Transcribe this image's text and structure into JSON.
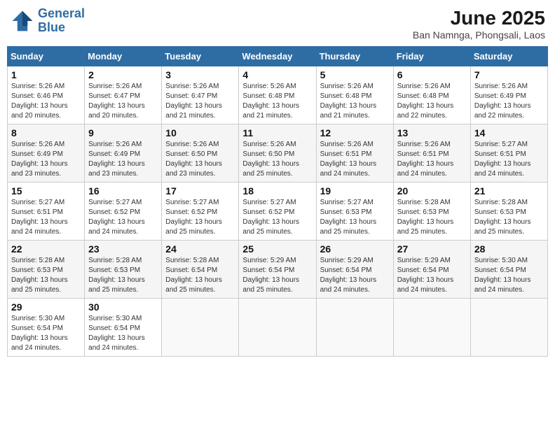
{
  "header": {
    "logo_line1": "General",
    "logo_line2": "Blue",
    "month_year": "June 2025",
    "location": "Ban Namnga, Phongsali, Laos"
  },
  "weekdays": [
    "Sunday",
    "Monday",
    "Tuesday",
    "Wednesday",
    "Thursday",
    "Friday",
    "Saturday"
  ],
  "weeks": [
    [
      {
        "day": "1",
        "sunrise": "5:26 AM",
        "sunset": "6:46 PM",
        "daylight": "13 hours and 20 minutes."
      },
      {
        "day": "2",
        "sunrise": "5:26 AM",
        "sunset": "6:47 PM",
        "daylight": "13 hours and 20 minutes."
      },
      {
        "day": "3",
        "sunrise": "5:26 AM",
        "sunset": "6:47 PM",
        "daylight": "13 hours and 21 minutes."
      },
      {
        "day": "4",
        "sunrise": "5:26 AM",
        "sunset": "6:48 PM",
        "daylight": "13 hours and 21 minutes."
      },
      {
        "day": "5",
        "sunrise": "5:26 AM",
        "sunset": "6:48 PM",
        "daylight": "13 hours and 21 minutes."
      },
      {
        "day": "6",
        "sunrise": "5:26 AM",
        "sunset": "6:48 PM",
        "daylight": "13 hours and 22 minutes."
      },
      {
        "day": "7",
        "sunrise": "5:26 AM",
        "sunset": "6:49 PM",
        "daylight": "13 hours and 22 minutes."
      }
    ],
    [
      {
        "day": "8",
        "sunrise": "5:26 AM",
        "sunset": "6:49 PM",
        "daylight": "13 hours and 23 minutes."
      },
      {
        "day": "9",
        "sunrise": "5:26 AM",
        "sunset": "6:49 PM",
        "daylight": "13 hours and 23 minutes."
      },
      {
        "day": "10",
        "sunrise": "5:26 AM",
        "sunset": "6:50 PM",
        "daylight": "13 hours and 23 minutes."
      },
      {
        "day": "11",
        "sunrise": "5:26 AM",
        "sunset": "6:50 PM",
        "daylight": "13 hours and 25 minutes."
      },
      {
        "day": "12",
        "sunrise": "5:26 AM",
        "sunset": "6:51 PM",
        "daylight": "13 hours and 24 minutes."
      },
      {
        "day": "13",
        "sunrise": "5:26 AM",
        "sunset": "6:51 PM",
        "daylight": "13 hours and 24 minutes."
      },
      {
        "day": "14",
        "sunrise": "5:27 AM",
        "sunset": "6:51 PM",
        "daylight": "13 hours and 24 minutes."
      }
    ],
    [
      {
        "day": "15",
        "sunrise": "5:27 AM",
        "sunset": "6:51 PM",
        "daylight": "13 hours and 24 minutes."
      },
      {
        "day": "16",
        "sunrise": "5:27 AM",
        "sunset": "6:52 PM",
        "daylight": "13 hours and 24 minutes."
      },
      {
        "day": "17",
        "sunrise": "5:27 AM",
        "sunset": "6:52 PM",
        "daylight": "13 hours and 25 minutes."
      },
      {
        "day": "18",
        "sunrise": "5:27 AM",
        "sunset": "6:52 PM",
        "daylight": "13 hours and 25 minutes."
      },
      {
        "day": "19",
        "sunrise": "5:27 AM",
        "sunset": "6:53 PM",
        "daylight": "13 hours and 25 minutes."
      },
      {
        "day": "20",
        "sunrise": "5:28 AM",
        "sunset": "6:53 PM",
        "daylight": "13 hours and 25 minutes."
      },
      {
        "day": "21",
        "sunrise": "5:28 AM",
        "sunset": "6:53 PM",
        "daylight": "13 hours and 25 minutes."
      }
    ],
    [
      {
        "day": "22",
        "sunrise": "5:28 AM",
        "sunset": "6:53 PM",
        "daylight": "13 hours and 25 minutes."
      },
      {
        "day": "23",
        "sunrise": "5:28 AM",
        "sunset": "6:53 PM",
        "daylight": "13 hours and 25 minutes."
      },
      {
        "day": "24",
        "sunrise": "5:28 AM",
        "sunset": "6:54 PM",
        "daylight": "13 hours and 25 minutes."
      },
      {
        "day": "25",
        "sunrise": "5:29 AM",
        "sunset": "6:54 PM",
        "daylight": "13 hours and 25 minutes."
      },
      {
        "day": "26",
        "sunrise": "5:29 AM",
        "sunset": "6:54 PM",
        "daylight": "13 hours and 24 minutes."
      },
      {
        "day": "27",
        "sunrise": "5:29 AM",
        "sunset": "6:54 PM",
        "daylight": "13 hours and 24 minutes."
      },
      {
        "day": "28",
        "sunrise": "5:30 AM",
        "sunset": "6:54 PM",
        "daylight": "13 hours and 24 minutes."
      }
    ],
    [
      {
        "day": "29",
        "sunrise": "5:30 AM",
        "sunset": "6:54 PM",
        "daylight": "13 hours and 24 minutes."
      },
      {
        "day": "30",
        "sunrise": "5:30 AM",
        "sunset": "6:54 PM",
        "daylight": "13 hours and 24 minutes."
      },
      null,
      null,
      null,
      null,
      null
    ]
  ]
}
